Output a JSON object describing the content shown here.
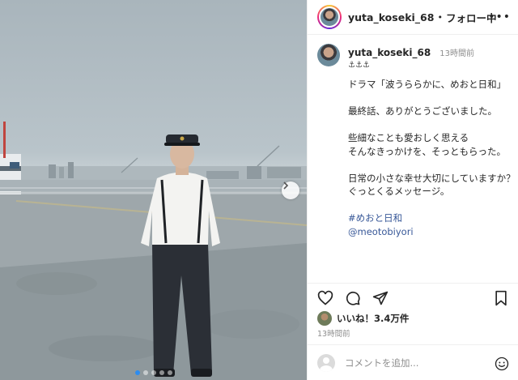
{
  "post": {
    "username": "yuta_koseki_68",
    "separator": "•",
    "follow_status": "フォロー中",
    "more_icon": "ellipsis-icon"
  },
  "caption": {
    "username": "yuta_koseki_68",
    "time": "13時間前",
    "emoji": "⚓⚓⚓",
    "lines": [
      "ドラマ「波うららかに、めおと日和」",
      "最終話、ありがとうございました。",
      "些細なことも愛おしく思える",
      "そんなきっかけを、そっともらった。",
      "日常の小さな幸せ大切にしていますか？",
      "ぐっとくるメッセージ。",
      "#めおと日和",
      "@meotobiyori"
    ]
  },
  "actions": {
    "icons": [
      "heart-icon",
      "comment-icon",
      "share-icon",
      "bookmark-icon"
    ],
    "likes": "いいね！3.4万件",
    "posted_time": "13時間前"
  },
  "comment": {
    "placeholder": "コメントを追加...",
    "emoji_icon": "smiley-icon"
  },
  "carousel": {
    "total": 5,
    "current": 1
  },
  "colors": {
    "accent_blue": "#2d8cf0",
    "link": "#385898",
    "muted": "#8e8e8e",
    "border": "#efefef"
  }
}
